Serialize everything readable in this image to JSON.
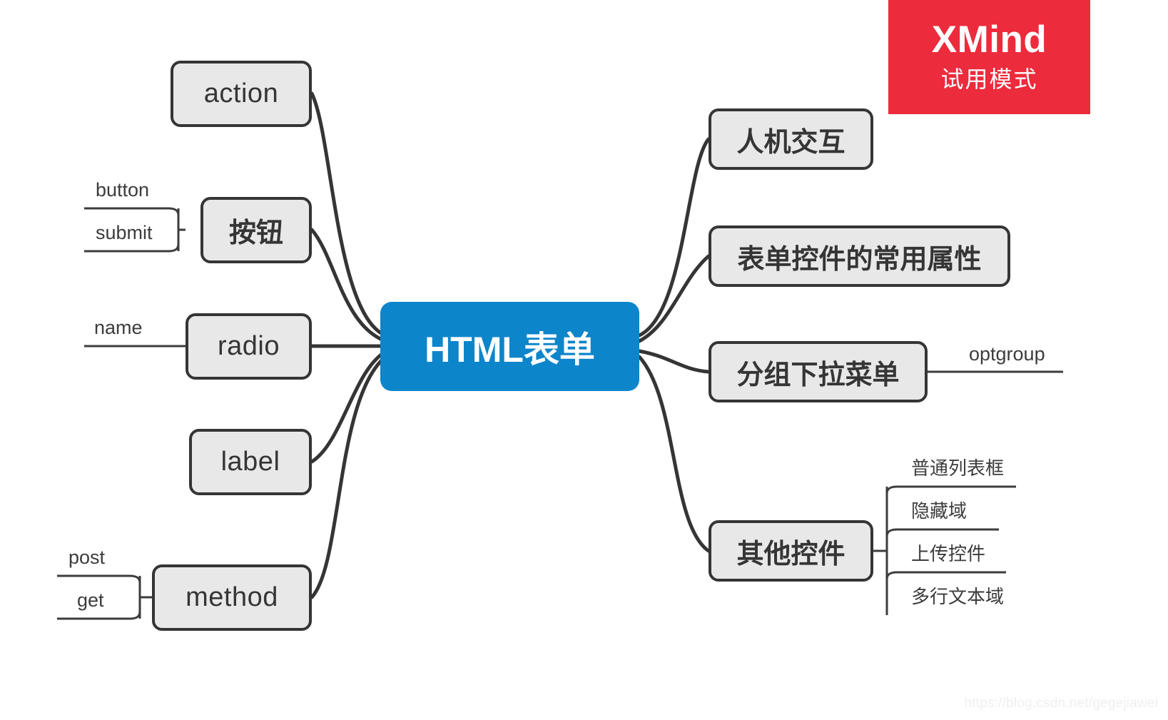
{
  "diagram": {
    "type": "mindmap",
    "title": "HTML表单",
    "root": {
      "label": "HTML表单",
      "color": "#0d85ca",
      "text_color": "#ffffff"
    },
    "node_style": {
      "fill": "#e8e8e8",
      "border": "#353535",
      "text": "#353535"
    },
    "left_branches": [
      {
        "label": "action",
        "script": "latin",
        "children": []
      },
      {
        "label": "按钮",
        "script": "cjk",
        "children": [
          {
            "label": "button"
          },
          {
            "label": "submit"
          }
        ]
      },
      {
        "label": "radio",
        "script": "latin",
        "children": [
          {
            "label": "name"
          }
        ]
      },
      {
        "label": "label",
        "script": "latin",
        "children": []
      },
      {
        "label": "method",
        "script": "latin",
        "children": [
          {
            "label": "post"
          },
          {
            "label": "get"
          }
        ]
      }
    ],
    "right_branches": [
      {
        "label": "人机交互",
        "script": "cjk",
        "children": []
      },
      {
        "label": "表单控件的常用属性",
        "script": "cjk",
        "children": []
      },
      {
        "label": "分组下拉菜单",
        "script": "cjk",
        "children": [
          {
            "label": "optgroup"
          }
        ]
      },
      {
        "label": "其他控件",
        "script": "cjk",
        "children": [
          {
            "label": "普通列表框"
          },
          {
            "label": "隐藏域"
          },
          {
            "label": "上传控件"
          },
          {
            "label": "多行文本域"
          }
        ]
      }
    ]
  },
  "watermarks": {
    "xmind": {
      "brand": "XMind",
      "trial": "试用模式",
      "color": "#ec2b3c"
    },
    "site": "https://blog.csdn.net/gegejiawei"
  }
}
